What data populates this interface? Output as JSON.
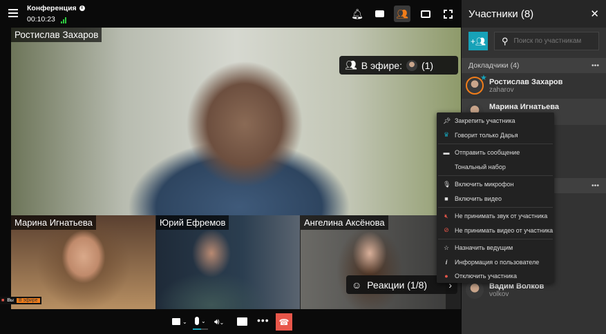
{
  "header": {
    "title": "Конференция",
    "timer": "00:10:23"
  },
  "stage": {
    "main_name": "Ростислав Захаров",
    "on_air_label": "В эфире:",
    "on_air_count": "(1)",
    "tiles": [
      {
        "name": "Марина Игнатьева"
      },
      {
        "name": "Юрий Ефремов"
      },
      {
        "name": "Ангелина Аксёнова"
      }
    ],
    "reactions_label": "Реакции (1/8)",
    "self_label": "Вы",
    "self_status": "В эфире"
  },
  "sidebar": {
    "title": "Участники (8)",
    "search_placeholder": "Поиск по участникам",
    "section1": "Докладчики (4)",
    "participants": [
      {
        "name": "Ростислав Захаров",
        "login": "zaharov"
      },
      {
        "name": "Марина Игнатьева",
        "login": ""
      },
      {
        "name": "Вадим Волков",
        "login": "volkov"
      }
    ]
  },
  "menu": {
    "items": [
      "Закрепить участника",
      "Говорит только Дарья",
      "Отправить сообщение",
      "Тональный набор",
      "Включить микрофон",
      "Включить видео",
      "Не принимать звук от участника",
      "Не принимать видео от участника",
      "Назначить ведущим",
      "Информация о пользователе",
      "Отключить участника"
    ]
  },
  "colors": {
    "accent": "#f07d1a",
    "teal": "#17a2b8",
    "hangup": "#e8564a",
    "signal": "#2ecc40"
  }
}
